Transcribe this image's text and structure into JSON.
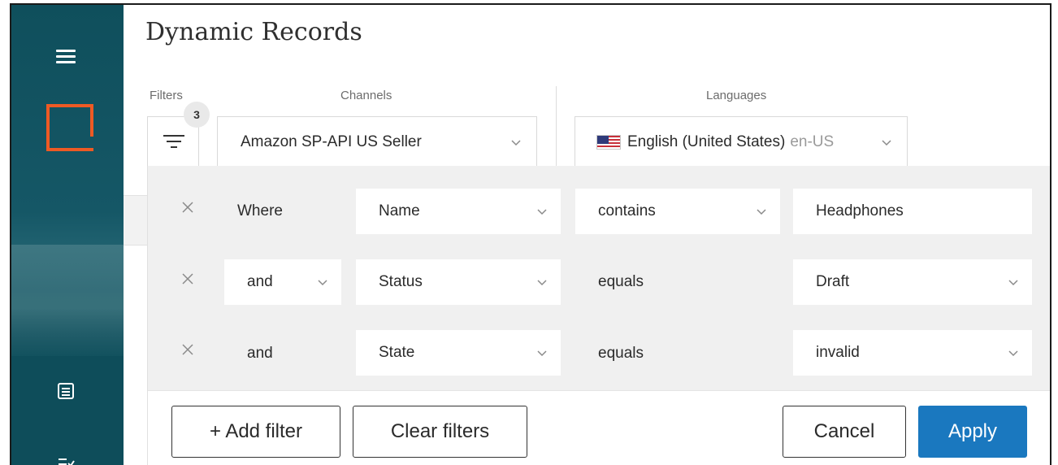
{
  "page": {
    "title": "Dynamic Records"
  },
  "toolbar": {
    "filters_label": "Filters",
    "filter_count": "3",
    "channels_label": "Channels",
    "channel_value": "Amazon SP-API US Seller",
    "languages_label": "Languages",
    "language_value": "English (United States)",
    "language_code": "en-US"
  },
  "filters": [
    {
      "conjunction": "Where",
      "field": "Name",
      "operator": "contains",
      "value": "Headphones"
    },
    {
      "conjunction": "and",
      "field": "Status",
      "operator": "equals",
      "value": "Draft"
    },
    {
      "conjunction": "and",
      "field": "State",
      "operator": "equals",
      "value": "invalid"
    }
  ],
  "actions": {
    "add_filter": "+ Add filter",
    "clear_filters": "Clear filters",
    "cancel": "Cancel",
    "apply": "Apply"
  },
  "icons": {
    "menu": "hamburger-icon",
    "logo": "logo-icon",
    "records": "records-icon",
    "tasks": "tasks-icon",
    "filter": "filter-icon",
    "remove": "close-icon",
    "dropdown": "chevron-down-icon",
    "flag": "us-flag-icon"
  },
  "colors": {
    "sidebar": "#0f4f5c",
    "brand": "#ee5a24",
    "primary": "#1a78bf",
    "panel": "#f0f0f0"
  }
}
